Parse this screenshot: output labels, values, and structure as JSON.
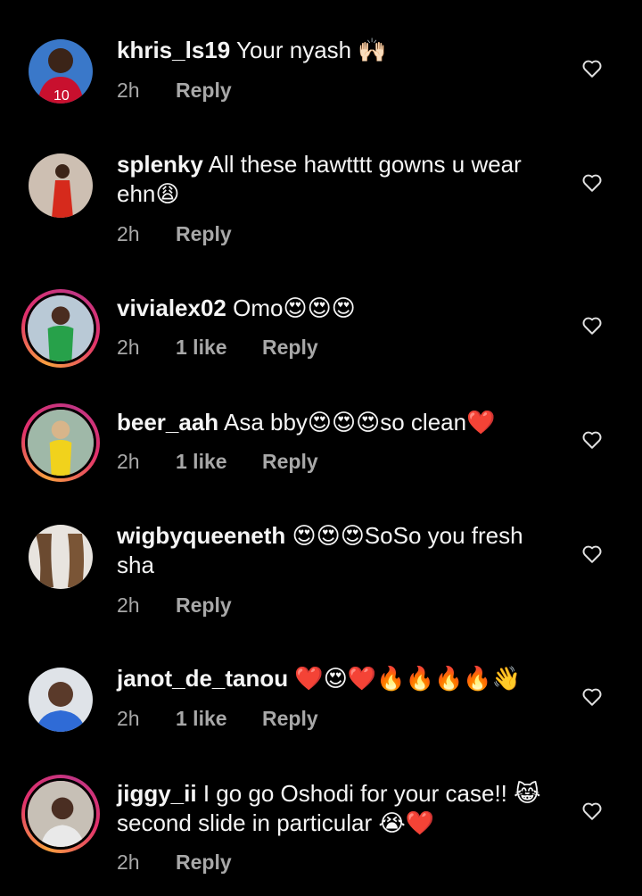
{
  "comments": [
    {
      "username": "khris_ls19",
      "text": "Your nyash 🙌🏻",
      "time": "2h",
      "likes": "",
      "reply": "Reply"
    },
    {
      "username": "splenky",
      "text": "All these hawtttt gowns u wear ehn😩",
      "time": "2h",
      "likes": "",
      "reply": "Reply"
    },
    {
      "username": "vivialex02",
      "text": "Omo😍😍😍",
      "time": "2h",
      "likes": "1 like",
      "reply": "Reply"
    },
    {
      "username": "beer_aah",
      "text": "Asa bby😍😍😍so clean❤️",
      "time": "2h",
      "likes": "1 like",
      "reply": "Reply"
    },
    {
      "username": "wigbyqueeneth",
      "text": "😍😍😍SoSo you fresh sha",
      "time": "2h",
      "likes": "",
      "reply": "Reply"
    },
    {
      "username": "janot_de_tanou",
      "text": "❤️😍❤️🔥🔥🔥🔥👋",
      "time": "2h",
      "likes": "1 like",
      "reply": "Reply"
    },
    {
      "username": "jiggy_ii",
      "text": "I go go Oshodi for your case!! 😹second slide in particular 😭❤️",
      "time": "2h",
      "likes": "",
      "reply": "Reply"
    }
  ],
  "colors": {
    "background": "#000000",
    "text": "#f5f5f5",
    "meta": "#a8a8a8"
  },
  "icons": {
    "like": "heart-outline-icon"
  }
}
